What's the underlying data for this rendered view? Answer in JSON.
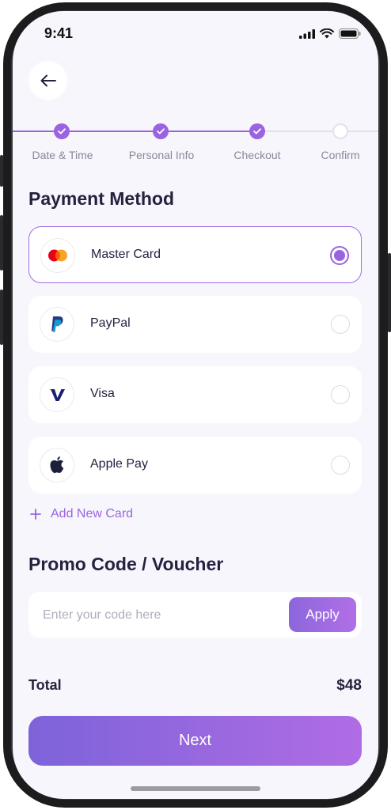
{
  "status_bar": {
    "time": "9:41"
  },
  "stepper": {
    "steps": [
      {
        "label": "Date &  Time",
        "done": true
      },
      {
        "label": "Personal Info",
        "done": true
      },
      {
        "label": "Checkout",
        "done": true
      },
      {
        "label": "Confirm",
        "done": false
      }
    ],
    "accent": "#9a64e0"
  },
  "payment": {
    "title": "Payment Method",
    "methods": [
      {
        "label": "Master Card",
        "icon": "mastercard-icon",
        "selected": true
      },
      {
        "label": "PayPal",
        "icon": "paypal-icon",
        "selected": false
      },
      {
        "label": "Visa",
        "icon": "visa-icon",
        "selected": false
      },
      {
        "label": "Apple Pay",
        "icon": "apple-icon",
        "selected": false
      }
    ],
    "add_card_label": "Add New Card"
  },
  "promo": {
    "title": "Promo Code / Voucher",
    "placeholder": "Enter your code here",
    "value": "",
    "apply_label": "Apply"
  },
  "summary": {
    "total_label": "Total",
    "total_value": "$48"
  },
  "footer": {
    "next_label": "Next"
  }
}
